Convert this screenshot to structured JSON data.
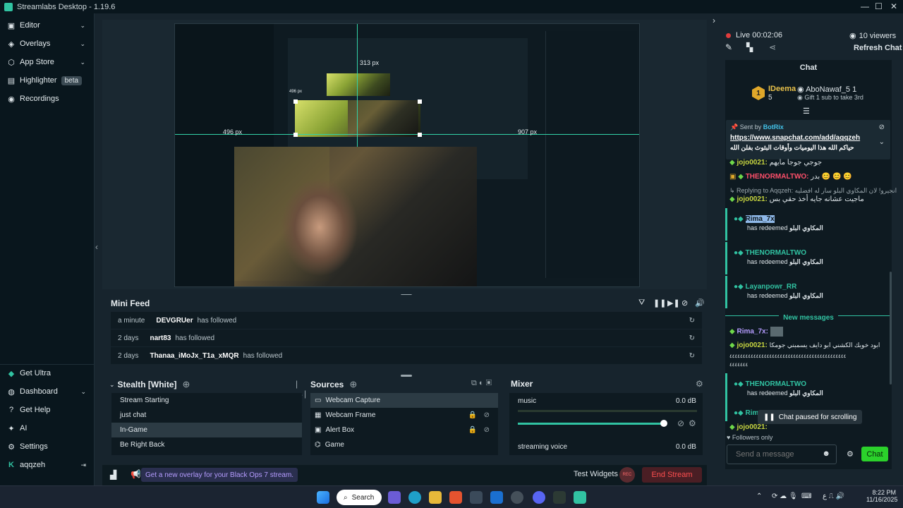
{
  "titlebar": {
    "title": "Streamlabs Desktop - 1.19.6"
  },
  "sidebar": {
    "items": [
      {
        "label": "Editor",
        "icon": "editor-icon"
      },
      {
        "label": "Overlays",
        "icon": "overlays-icon"
      },
      {
        "label": "App Store",
        "icon": "app-store-icon"
      },
      {
        "label": "Highlighter",
        "icon": "highlighter-icon",
        "badge": "beta"
      },
      {
        "label": "Recordings",
        "icon": "recordings-icon"
      }
    ],
    "bottom": [
      {
        "label": "Get Ultra"
      },
      {
        "label": "Dashboard"
      },
      {
        "label": "Get Help"
      },
      {
        "label": "AI"
      },
      {
        "label": "Settings"
      }
    ],
    "user": "aqqzeh"
  },
  "preview": {
    "labels": {
      "left": "496 px",
      "right": "907 px",
      "top": "313 px",
      "mid": "496 px"
    }
  },
  "minifeed": {
    "title": "Mini Feed",
    "rows": [
      {
        "time": "a minute",
        "user": "DEVGRUer",
        "action": "has followed"
      },
      {
        "time": "2 days",
        "user": "nart83",
        "action": "has followed"
      },
      {
        "time": "2 days",
        "user": "Thanaa_iMoJx_T1a_xMQR",
        "action": "has followed"
      }
    ]
  },
  "scenes": {
    "title": "Stealth [White]",
    "items": [
      "Stream Starting",
      "just chat",
      "In-Game",
      "Be Right Back"
    ],
    "selected": 2
  },
  "sources": {
    "title": "Sources",
    "items": [
      "Webcam Capture",
      "Webcam Frame",
      "Alert Box",
      "Game"
    ]
  },
  "mixer": {
    "title": "Mixer",
    "items": [
      {
        "name": "music",
        "level": "0.0 dB"
      },
      {
        "name": "streaming voice",
        "level": "0.0 dB"
      }
    ]
  },
  "footer": {
    "promo": "Get a new overlay for your Black Ops 7 stream.",
    "test_widgets": "Test Widgets",
    "rec": "REC",
    "end_stream": "End Stream"
  },
  "right": {
    "live": "Live 00:02:06",
    "viewers": "10 viewers",
    "refresh": "Refresh Chat",
    "chat_title": "Chat",
    "top_gifter": {
      "rank": "1",
      "name": "IDeema",
      "count": "5",
      "other": "AboNawaf_5",
      "other_count": "1",
      "note": "Gift 1 sub to take 3rd"
    },
    "pinned": {
      "sent_by": "Sent by",
      "bot": "BotRix",
      "link": "https://www.snapchat.com/add/aqqzeh",
      "text": "حياكم الله هذا اليوميات وأوقات البثوث بفلن الله"
    },
    "messages": [
      {
        "user": "jojo0021:",
        "text": "جوجي جوجا مايهم"
      },
      {
        "user": "THENORMALTWO:",
        "text": "بدر 😊 😊 😊"
      },
      {
        "reply": "Replying to Aqqzeh:",
        "reply_text": "انجيرو! لان المكاوي البلو سار له افضليه"
      },
      {
        "user": "jojo0021:",
        "text": "ماجيت عشانه جايه أخذ حقي بس"
      },
      {
        "user": "Rima_7x",
        "sub": "has redeemed",
        "reward": "المكاوي البلو"
      },
      {
        "user": "THENORMALTWO",
        "sub": "has redeemed",
        "reward": "المكاوي البلو"
      },
      {
        "user": "Layanpowr_RR",
        "sub": "has redeemed",
        "reward": "المكاوي البلو"
      }
    ],
    "new_messages": "New messages",
    "new": [
      {
        "user": "Rima_7x:"
      },
      {
        "user": "jojo0021:",
        "text": "ابود خوبك الكشني ابو دايف يسمبني جومكا"
      },
      {
        "text": "٤٤٤٤٤٤٤٤٤٤٤٤٤٤٤٤٤٤٤٤٤٤٤٤٤٤٤٤٤٤٤٤٤٤٤٤٤٤٤٤٤٤٤٤"
      },
      {
        "text": "٤٤٤٤٤٤٤"
      },
      {
        "user": "THENORMALTWO",
        "sub": "has redeemed",
        "reward": "المكاوي البلو"
      },
      {
        "user": "Rima_"
      },
      {
        "user": "jojo0021:"
      }
    ],
    "paused": "Chat paused for scrolling",
    "followers_only": "Followers only",
    "send_placeholder": "Send a message",
    "chat_btn": "Chat"
  },
  "taskbar": {
    "search": "Search",
    "time": "8:22 PM",
    "date": "11/16/2025"
  },
  "colors": {
    "accent": "#31c3a2",
    "live": "#e03c3c",
    "chat_btn": "#2bd12b",
    "end_stream": "#ff4f4f"
  }
}
